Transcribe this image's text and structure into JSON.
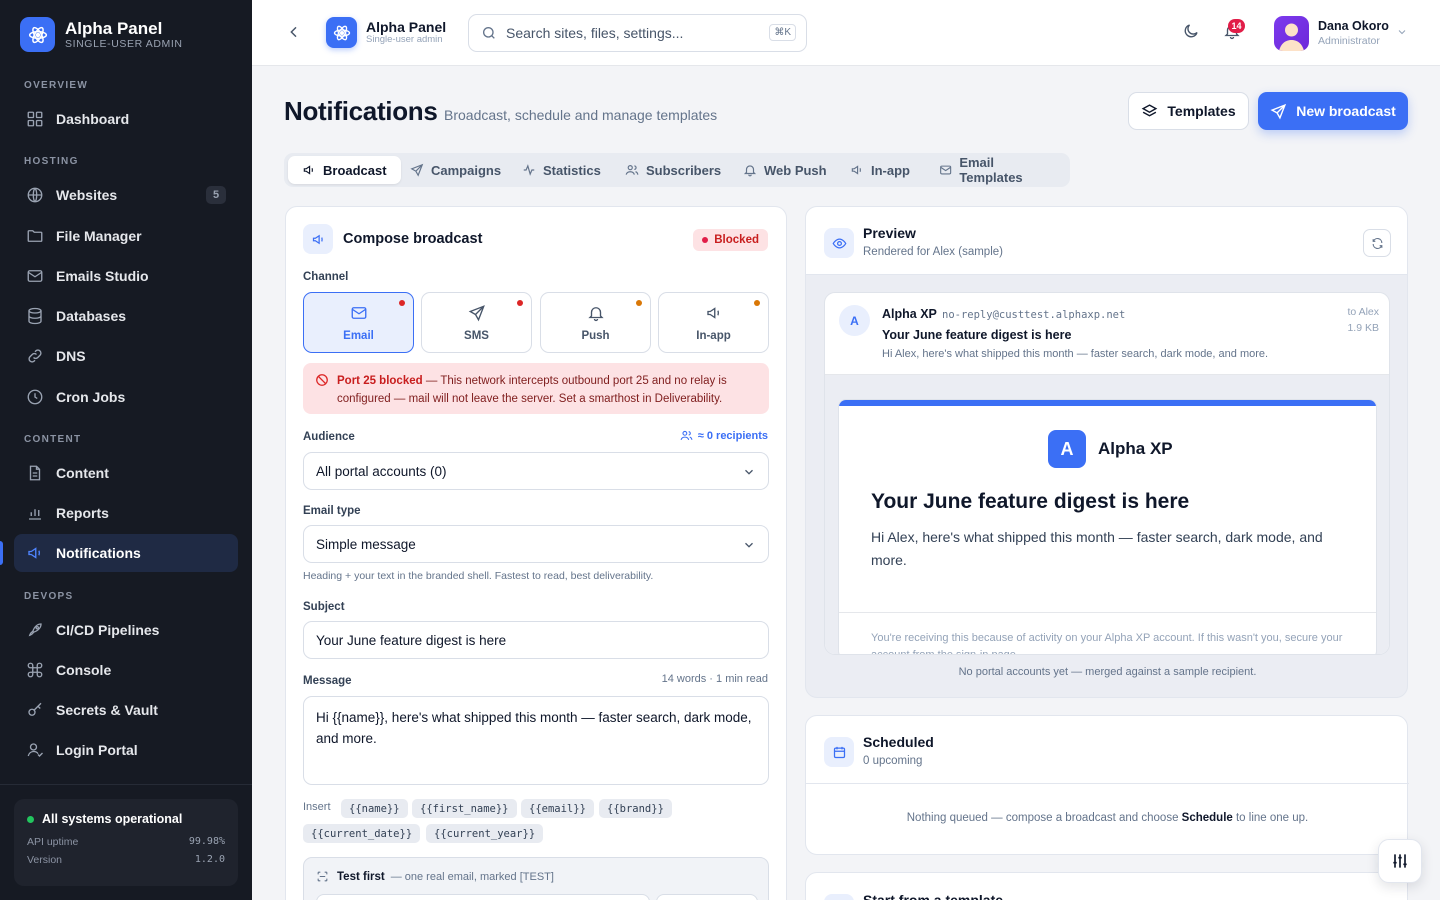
{
  "sidebar": {
    "brand_name": "Alpha Panel",
    "brand_sub": "SINGLE-USER ADMIN",
    "sections": {
      "overview": "OVERVIEW",
      "hosting": "HOSTING",
      "content": "CONTENT",
      "devops": "DEVOPS"
    },
    "items": [
      {
        "label": "Dashboard",
        "icon": "grid-icon"
      },
      {
        "label": "Websites",
        "icon": "globe-icon",
        "count": "5"
      },
      {
        "label": "File Manager",
        "icon": "folder-icon"
      },
      {
        "label": "Emails Studio",
        "icon": "mail-icon"
      },
      {
        "label": "Databases",
        "icon": "database-icon"
      },
      {
        "label": "DNS",
        "icon": "link-icon"
      },
      {
        "label": "Cron Jobs",
        "icon": "clock-icon"
      },
      {
        "label": "Content",
        "icon": "file-icon"
      },
      {
        "label": "Reports",
        "icon": "bar-chart-icon"
      },
      {
        "label": "Notifications",
        "icon": "megaphone-icon",
        "active": true
      },
      {
        "label": "CI/CD Pipelines",
        "icon": "rocket-icon"
      },
      {
        "label": "Console",
        "icon": "command-icon"
      },
      {
        "label": "Secrets & Vault",
        "icon": "key-icon"
      },
      {
        "label": "Login Portal",
        "icon": "user-check-icon"
      }
    ],
    "status": {
      "label": "All systems operational",
      "uptime_label": "API uptime",
      "uptime_value": "99.98%",
      "version_label": "Version",
      "version_value": "1.2.0"
    }
  },
  "topbar": {
    "app_title": "Alpha Panel",
    "app_sub": "Single-user admin",
    "search_placeholder": "Search sites, files, settings...",
    "search_kbd": "⌘K",
    "notification_count": "14",
    "user_name": "Dana Okoro",
    "user_role": "Administrator"
  },
  "page": {
    "title": "Notifications",
    "subtitle": "Broadcast, schedule and manage templates",
    "templates_button": "Templates",
    "new_broadcast_button": "New broadcast",
    "tabs": [
      "Broadcast",
      "Campaigns",
      "Statistics",
      "Subscribers",
      "Web Push",
      "In-app",
      "Email Templates"
    ]
  },
  "compose": {
    "title": "Compose broadcast",
    "status": "Blocked",
    "channel_label": "Channel",
    "channels": [
      {
        "label": "Email",
        "icon": "mail-icon",
        "status_color": "#dc2626"
      },
      {
        "label": "SMS",
        "icon": "send-icon",
        "status_color": "#dc2626"
      },
      {
        "label": "Push",
        "icon": "bell-icon",
        "status_color": "#d97706"
      },
      {
        "label": "In-app",
        "icon": "megaphone-icon",
        "status_color": "#d97706"
      }
    ],
    "alert_strong": "Port 25 blocked",
    "alert_text": " — This network intercepts outbound port 25 and no relay is configured — mail will not leave the server. Set a smarthost in Deliverability.",
    "audience_label": "Audience",
    "recipients": "≈ 0 recipients",
    "audience_value": "All portal accounts (0)",
    "email_type_label": "Email type",
    "email_type_value": "Simple message",
    "email_type_hint": "Heading + your text in the branded shell. Fastest to read, best deliverability.",
    "subject_label": "Subject",
    "subject_value": "Your June feature digest is here",
    "message_label": "Message",
    "word_count": "14 words · 1 min read",
    "message_value": "Hi {{name}}, here's what shipped this month — faster search, dark mode, and more.",
    "insert_label": "Insert",
    "insert_tokens": [
      "{{name}}",
      "{{first_name}}",
      "{{email}}",
      "{{brand}}",
      "{{current_date}}",
      "{{current_year}}"
    ],
    "test_title": "Test first",
    "test_sub": "— one real email, marked [TEST]"
  },
  "preview": {
    "title": "Preview",
    "subtitle": "Rendered for Alex (sample)",
    "from_name": "Alpha XP",
    "from_addr": "no-reply@custtest.alphaxp.net",
    "avatar_letter": "A",
    "subject": "Your June feature digest is here",
    "snippet": "Hi Alex, here's what shipped this month — faster search, dark mode, and more.",
    "to": "to Alex",
    "size": "1.9 KB",
    "shell_logo": "A",
    "shell_brand": "Alpha XP",
    "shell_heading": "Your June feature digest is here",
    "shell_body": "Hi Alex, here's what shipped this month — faster search, dark mode, and more.",
    "shell_footer": "You're receiving this because of activity on your Alpha XP account. If this wasn't you, secure your account from the sign-in page.",
    "note": "No portal accounts yet — merged against a sample recipient."
  },
  "scheduled": {
    "title": "Scheduled",
    "subtitle": "0 upcoming",
    "empty_pre": "Nothing queued — compose a broadcast and choose ",
    "empty_bold": "Schedule",
    "empty_post": " to line one up."
  },
  "templates_card": {
    "title": "Start from a template"
  },
  "colors": {
    "accent": "#3b6ff5",
    "sidebar_bg": "#161a23",
    "danger": "#dc2626",
    "warning": "#d97706",
    "success": "#22c55e"
  }
}
